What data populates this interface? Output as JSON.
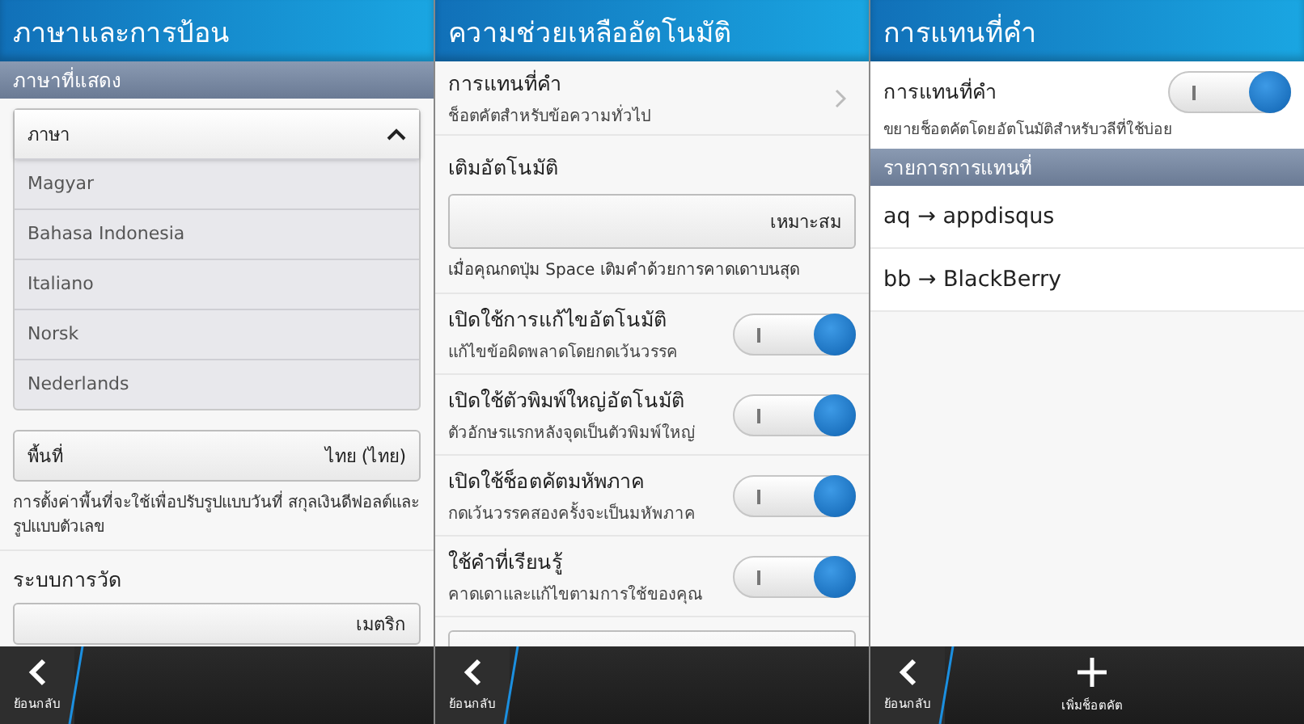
{
  "language_panel": {
    "title": "ภาษาและการป้อน",
    "section_header": "ภาษาที่แสดง",
    "language_dropdown": {
      "label": "ภาษา",
      "expanded": true,
      "options": [
        "Magyar",
        "Bahasa Indonesia",
        "Italiano",
        "Norsk",
        "Nederlands"
      ]
    },
    "region_field": {
      "label": "พื้นที่",
      "value": "ไทย (ไทย)"
    },
    "region_note": "การตั้งค่าพื้นที่จะใช้เพื่อปรับรูปแบบวันที่ สกุลเงินดีฟอลต์และรูปแบบตัวเลข",
    "measurement": {
      "label": "ระบบการวัด",
      "value": "เมตริก"
    },
    "bottom_bar": {
      "back_label": "ย้อนกลับ"
    }
  },
  "assist_panel": {
    "title": "ความช่วยเหลืออัตโนมัติ",
    "substitution_item": {
      "title": "การแทนที่คำ",
      "subtitle": "ช็อตคัตสำหรับข้อความทั่วไป"
    },
    "autocomplete": {
      "label": "เติมอัตโนมัติ",
      "value": "เหมาะสม",
      "note": "เมื่อคุณกดปุ่ม Space เติมคำด้วยการคาดเดาบนสุด"
    },
    "toggles": [
      {
        "title": "เปิดใช้การแก้ไขอัตโนมัติ",
        "subtitle": "แก้ไขข้อผิดพลาดโดยกดเว้นวรรค",
        "on": true
      },
      {
        "title": "เปิดใช้ตัวพิมพ์ใหญ่อัตโนมัติ",
        "subtitle": "ตัวอักษรแรกหลังจุดเป็นตัวพิมพ์ใหญ่",
        "on": true
      },
      {
        "title": "เปิดใช้ช็อตคัตมหัพภาค",
        "subtitle": "กดเว้นวรรคสองครั้งจะเป็นมหัพภาค",
        "on": true
      },
      {
        "title": "ใช้คำที่เรียนรู้",
        "subtitle": "คาดเดาและแก้ไขตามการใช้ของคุณ",
        "on": true
      }
    ],
    "bottom_bar": {
      "back_label": "ย้อนกลับ"
    }
  },
  "substitution_panel": {
    "title": "การแทนที่คำ",
    "toggle": {
      "title": "การแทนที่คำ",
      "subtitle": "ขยายช็อตคัตโดยอัตโนมัติสำหรับวลีที่ใช้บ่อย",
      "on": true
    },
    "section_header": "รายการการแทนที่",
    "entries": [
      "aq → appdisqus",
      "bb → BlackBerry"
    ],
    "bottom_bar": {
      "back_label": "ย้อนกลับ",
      "action_label": "เพิ่มช็อตคัต"
    }
  }
}
